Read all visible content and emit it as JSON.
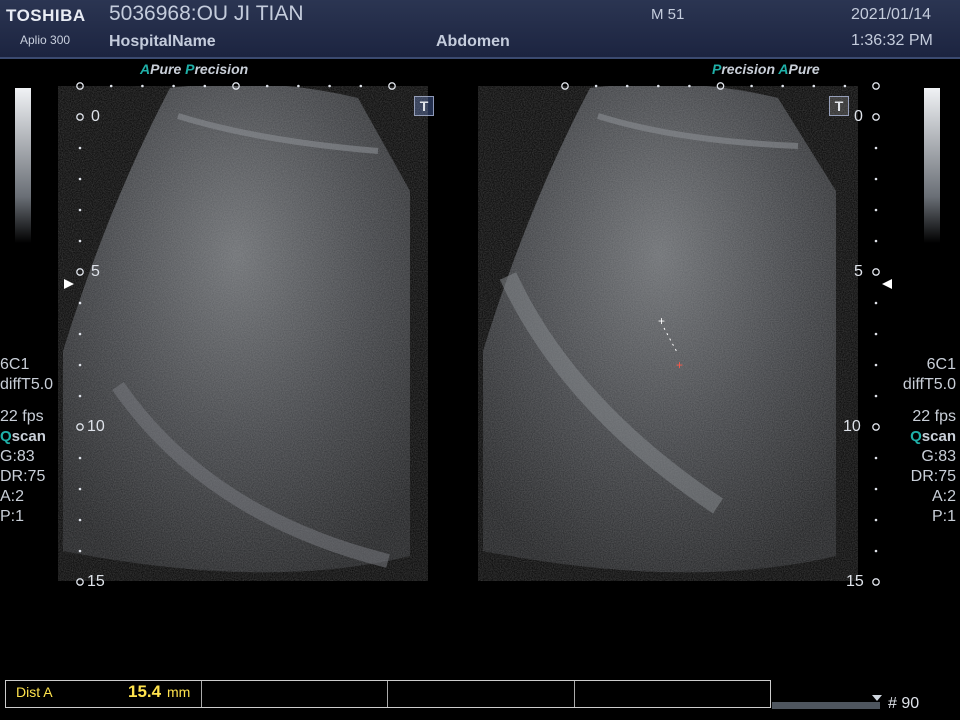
{
  "header": {
    "brand": "TOSHIBA",
    "model": "Aplio 300",
    "patient": "5036968:OU JI TIAN",
    "hospital": "HospitalName",
    "mode": "M 51",
    "preset": "Abdomen",
    "date": "2021/01/14",
    "time": "1:36:32 PM"
  },
  "left_panel": {
    "tag_a": "A",
    "tag_pure": "Pure",
    "tag_p": "P",
    "tag_precision": "recision",
    "scale": [
      "0",
      "5",
      "10",
      "15"
    ],
    "probe": "6C1",
    "filter": "diffT5.0",
    "fps": "22 fps",
    "q_letter": "Q",
    "scan": "scan",
    "gain": "G:83",
    "dr": "DR:75",
    "a": "A:2",
    "p": "P:1",
    "t_icon": "T"
  },
  "right_panel": {
    "tag_p": "P",
    "tag_precision": "recision",
    "tag_a": "A",
    "tag_pure": "Pure",
    "scale": [
      "0",
      "5",
      "10",
      "15"
    ],
    "probe": "6C1",
    "filter": "diffT5.0",
    "fps": "22 fps",
    "q_letter": "Q",
    "scan": "scan",
    "gain": "G:83",
    "dr": "DR:75",
    "a": "A:2",
    "p": "P:1",
    "t_icon": "T"
  },
  "measurement": {
    "label": "Dist A",
    "value": "15.4",
    "unit": "mm"
  },
  "frame": "# 90",
  "colors": {
    "header_bg": "#243050",
    "accent": "#1fb0a8",
    "measure": "#ffe34d"
  }
}
